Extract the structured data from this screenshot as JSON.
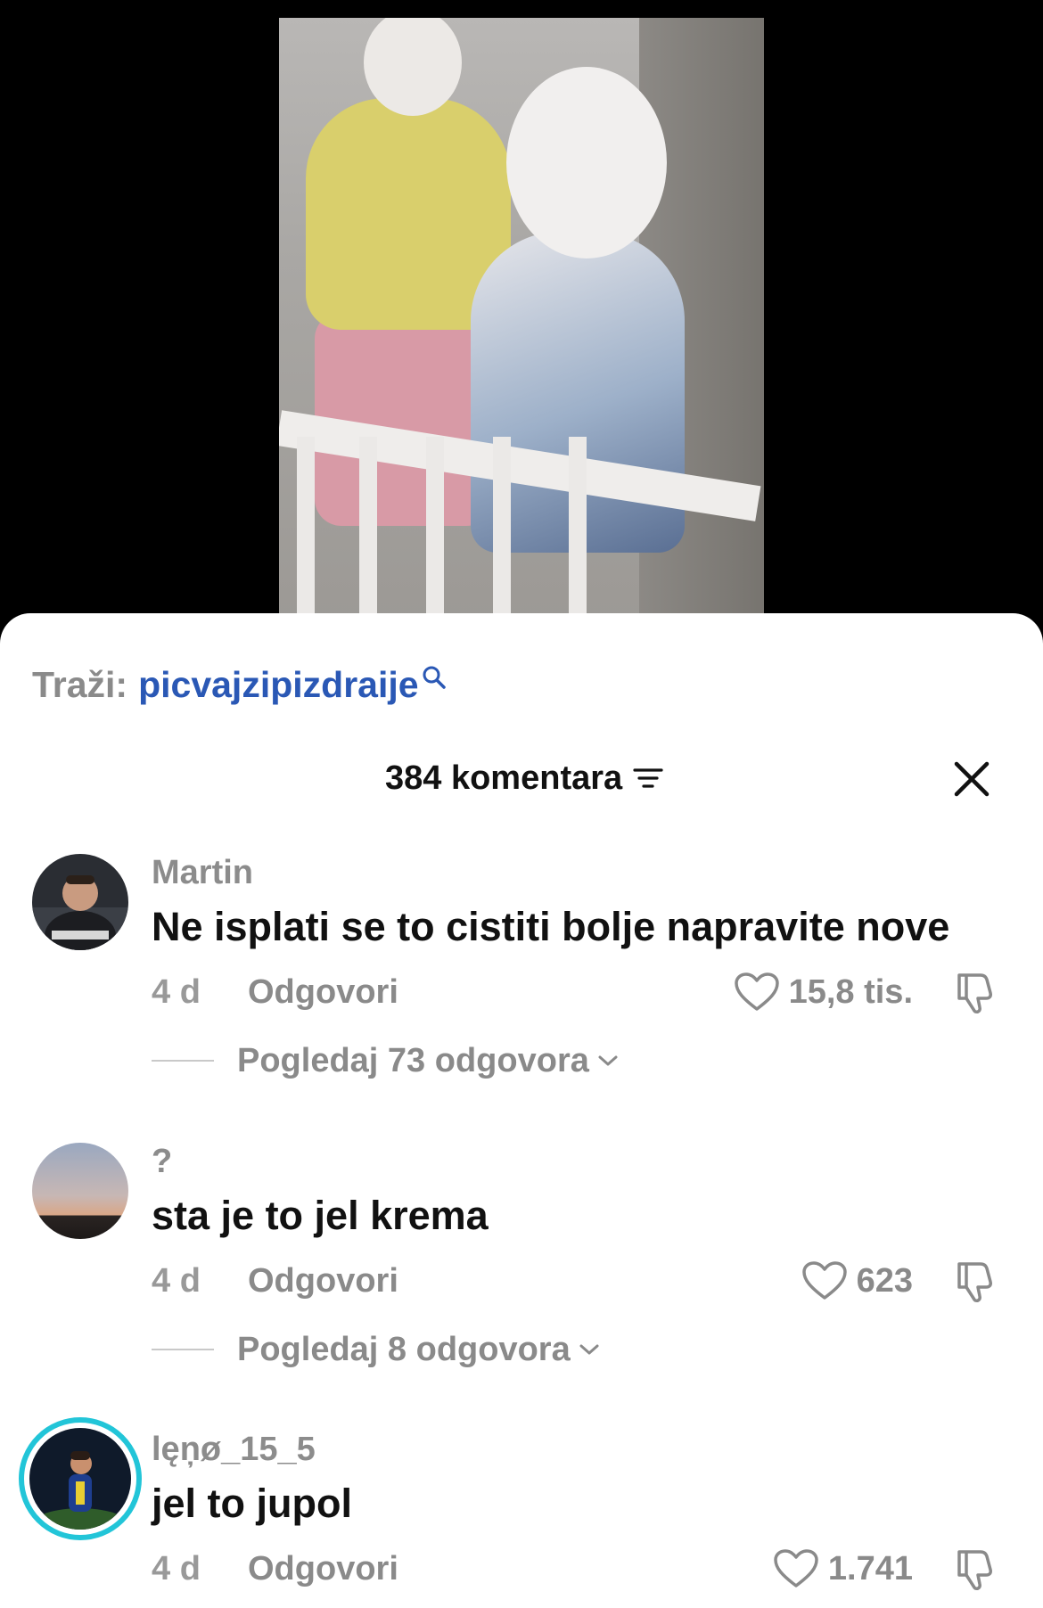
{
  "search": {
    "label": "Traži:",
    "term": "picvajzipizdraije"
  },
  "header": {
    "title": "384 komentara"
  },
  "comments": [
    {
      "name": "Martin",
      "text": "Ne isplati se to cistiti bolje napravite nove",
      "time": "4 d",
      "reply_label": "Odgovori",
      "likes": "15,8 tis.",
      "view_replies": "Pogledaj 73 odgovora",
      "avatar_ring_color": ""
    },
    {
      "name": "?",
      "text": "sta je to jel krema",
      "time": "4 d",
      "reply_label": "Odgovori",
      "likes": "623",
      "view_replies": "Pogledaj 8 odgovora",
      "avatar_ring_color": ""
    },
    {
      "name": "lęņø_15_5",
      "text": "jel to jupol",
      "time": "4 d",
      "reply_label": "Odgovori",
      "likes": "1.741",
      "view_replies": "",
      "avatar_ring_color": "#22c5d8"
    }
  ],
  "colors": {
    "accent_link": "#2a58b5",
    "muted_text": "#8a8a8a",
    "story_ring": "#22c5d8"
  },
  "icons": [
    "search-icon",
    "sort-icon",
    "close-icon",
    "heart-icon",
    "dislike-icon",
    "chevron-down-icon"
  ]
}
